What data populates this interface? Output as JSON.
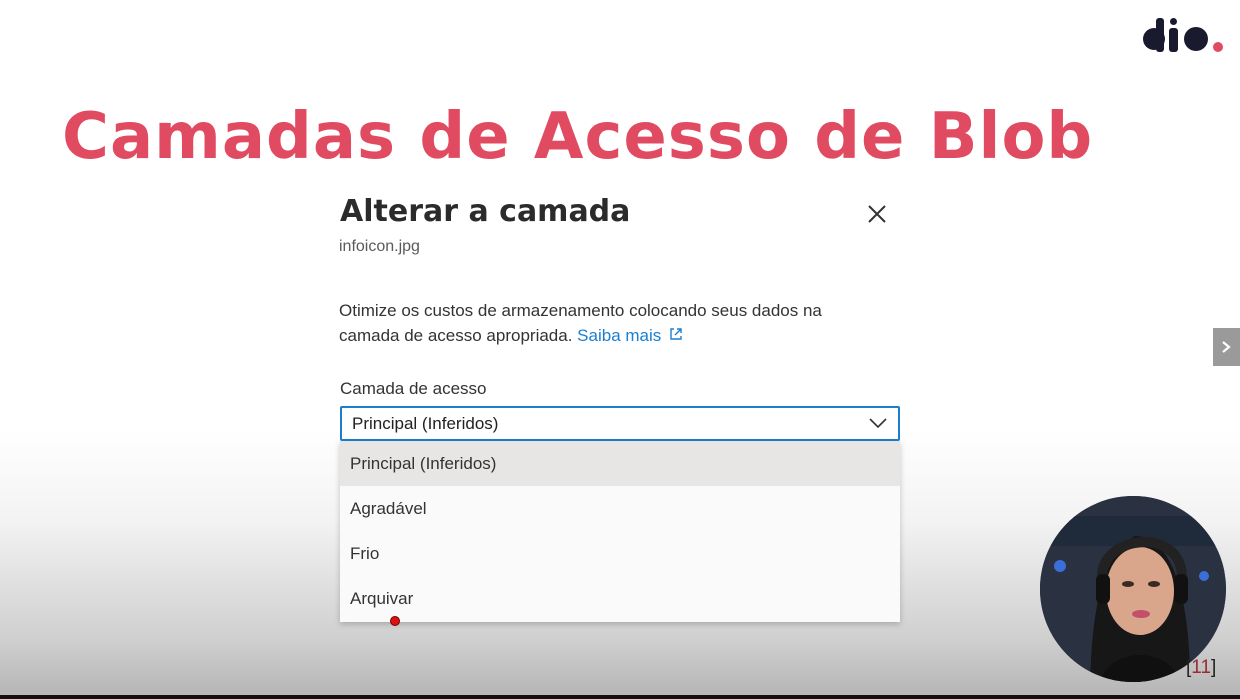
{
  "slide": {
    "title": "Camadas de Acesso de Blob",
    "page_number": "11",
    "page_bracket_open": "[",
    "page_bracket_close": "]",
    "logo_text": "dio."
  },
  "dialog": {
    "title": "Alterar a camada",
    "file_name": "infoicon.jpg",
    "description": "Otimize os custos de armazenamento colocando seus dados na camada de acesso apropriada.",
    "learn_more": "Saiba mais",
    "field_label": "Camada de acesso",
    "selected_value": "Principal (Inferidos)",
    "options": [
      {
        "label": "Principal (Inferidos)"
      },
      {
        "label": "Agradável"
      },
      {
        "label": "Frio"
      },
      {
        "label": "Arquivar"
      }
    ]
  },
  "colors": {
    "title": "#e14b61",
    "accent": "#1b7fcf",
    "logo": "#1a1a2e",
    "logo_dot": "#e14b61"
  },
  "icons": {
    "close": "close-icon",
    "external_link": "external-link-icon",
    "chevron": "chevron-down-icon",
    "next": "chevron-right-icon"
  }
}
